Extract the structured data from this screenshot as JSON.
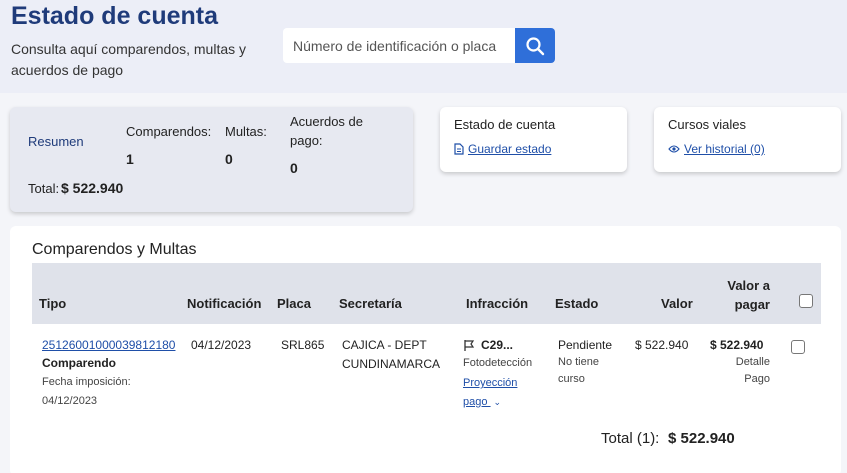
{
  "header": {
    "title": "Estado de cuenta",
    "subtitle": "Consulta aquí comparendos, multas y acuerdos de pago"
  },
  "search": {
    "placeholder": "Número de identificación o placa",
    "button_icon": "search-icon"
  },
  "summary": {
    "link_label": "Resumen",
    "comparendos_label": "Comparendos:",
    "comparendos_value": "1",
    "multas_label": "Multas:",
    "multas_value": "0",
    "acuerdos_label": "Acuerdos de pago:",
    "acuerdos_value": "0",
    "total_label": "Total:",
    "total_value": "$ 522.940"
  },
  "estado_card": {
    "title": "Estado de cuenta",
    "link_label": "Guardar estado",
    "link_icon": "document-icon"
  },
  "cursos_card": {
    "title": "Cursos viales",
    "link_label": "Ver historial (0)",
    "link_icon": "eye-icon"
  },
  "table": {
    "title": "Comparendos y Multas",
    "columns": {
      "tipo": "Tipo",
      "notificacion": "Notificación",
      "placa": "Placa",
      "secretaria": "Secretaría",
      "infraccion": "Infracción",
      "estado": "Estado",
      "valor": "Valor",
      "valor_pagar": "Valor a pagar"
    },
    "rows": [
      {
        "numero": "25126001000039812180",
        "tipo": "Comparendo",
        "fecha_label": "Fecha imposición:",
        "fecha": "04/12/2023",
        "notificacion": "04/12/2023",
        "placa": "SRL865",
        "secretaria": "CAJICA - DEPT CUNDINAMARCA",
        "infraccion_code": "C29...",
        "infraccion_tipo": "Fotodetección",
        "proyeccion": "Proyección pago",
        "estado": "Pendiente",
        "curso": "No tiene curso",
        "valor": "$ 522.940",
        "valor_pagar": "$ 522.940",
        "detalle": "Detalle Pago"
      }
    ],
    "total_label": "Total (1):",
    "total_value": "$ 522.940"
  },
  "colors": {
    "title": "#1f3b7a",
    "accent": "#2f6fd9",
    "link": "#1f4fa8"
  }
}
